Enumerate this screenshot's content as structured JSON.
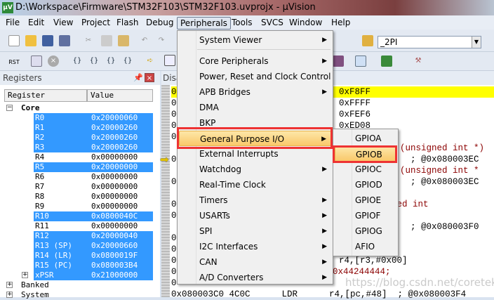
{
  "window": {
    "title": "D:\\Workspace\\Firmware\\STM32F103\\STM32F103.uvprojx - µVision",
    "logo": "µV"
  },
  "menubar": [
    "File",
    "Edit",
    "View",
    "Project",
    "Flash",
    "Debug",
    "Peripherals",
    "Tools",
    "SVCS",
    "Window",
    "Help"
  ],
  "toolbar": {
    "target_value": "_2PI",
    "rst_label": "RST"
  },
  "registers": {
    "title": "Registers",
    "col_register": "Register",
    "col_value": "Value",
    "core_label": "Core",
    "rows": [
      {
        "name": "R0",
        "value": "0x20000060",
        "sel": true
      },
      {
        "name": "R1",
        "value": "0x20000260",
        "sel": true
      },
      {
        "name": "R2",
        "value": "0x20000260",
        "sel": true
      },
      {
        "name": "R3",
        "value": "0x20000260",
        "sel": true
      },
      {
        "name": "R4",
        "value": "0x00000000",
        "sel": false
      },
      {
        "name": "R5",
        "value": "0x20000000",
        "sel": true
      },
      {
        "name": "R6",
        "value": "0x00000000",
        "sel": false
      },
      {
        "name": "R7",
        "value": "0x00000000",
        "sel": false
      },
      {
        "name": "R8",
        "value": "0x00000000",
        "sel": false
      },
      {
        "name": "R9",
        "value": "0x00000000",
        "sel": false
      },
      {
        "name": "R10",
        "value": "0x0800040C",
        "sel": true
      },
      {
        "name": "R11",
        "value": "0x00000000",
        "sel": false
      },
      {
        "name": "R12",
        "value": "0x20000040",
        "sel": true
      },
      {
        "name": "R13 (SP)",
        "value": "0x20000660",
        "sel": true
      },
      {
        "name": "R14 (LR)",
        "value": "0x0800019F",
        "sel": true
      },
      {
        "name": "R15 (PC)",
        "value": "0x080003B4",
        "sel": true
      },
      {
        "name": "xPSR",
        "value": "0x21000000",
        "sel": true
      }
    ],
    "banked_label": "Banked",
    "system_label": "System"
  },
  "disassembly": {
    "title": "Disa",
    "lines": [
      {
        "row": 0,
        "text": "0xF8FF",
        "red": false,
        "yellow": true
      },
      {
        "row": 1,
        "text": "0xFFFF",
        "red": false
      },
      {
        "row": 2,
        "text": "0xFEF6",
        "red": false
      },
      {
        "row": 3,
        "text": "0xED08",
        "red": false
      },
      {
        "row": 5,
        "text": "  = (unsigned int *)",
        "red": true
      },
      {
        "row": 6,
        "text": "      ; @0x080003EC",
        "red": false
      },
      {
        "row": 7,
        "text": "  = (unsigned int *",
        "red": true
      },
      {
        "row": 8,
        "text": "      ; @0x080003EC",
        "red": false
      },
      {
        "row": 9,
        "text": ")",
        "red": false
      },
      {
        "row": 10,
        "text": "R = (unsigned int",
        "red": true
      },
      {
        "row": 12,
        "text": "      ; @0x080003F0",
        "red": false
      },
      {
        "row": 15,
        "text": "r4,[r3,#0x00]",
        "red": false
      },
      {
        "row": 16,
        "text": "0x44244444;",
        "red": true
      }
    ],
    "last_line": "0x080003C0 4C0C      LDR      r4,[pc,#48]  ; @0x080003F4",
    "watermark": "https://blog.csdn.net/coreteker"
  },
  "peripherals_menu": {
    "items": [
      {
        "label": "System Viewer",
        "sub": true
      },
      {
        "label": "Core Peripherals",
        "sub": true
      },
      {
        "label": "Power, Reset and Clock Control",
        "sub": false
      },
      {
        "label": "APB Bridges",
        "sub": true
      },
      {
        "label": "DMA",
        "sub": false
      },
      {
        "label": "BKP",
        "sub": false
      },
      {
        "label": "General Purpose I/O",
        "sub": true,
        "hl": true
      },
      {
        "label": "External Interrupts",
        "sub": false
      },
      {
        "label": "Watchdog",
        "sub": true
      },
      {
        "label": "Real-Time Clock",
        "sub": false
      },
      {
        "label": "Timers",
        "sub": true
      },
      {
        "label": "USARTs",
        "sub": true
      },
      {
        "label": "SPI",
        "sub": true
      },
      {
        "label": "I2C Interfaces",
        "sub": true
      },
      {
        "label": "CAN",
        "sub": true
      },
      {
        "label": "A/D Converters",
        "sub": true
      }
    ]
  },
  "gpio_submenu": [
    "GPIOA",
    "GPIOB",
    "GPIOC",
    "GPIOD",
    "GPIOE",
    "GPIOF",
    "GPIOG",
    "AFIO"
  ],
  "colors": {
    "selection": "#3399ff",
    "highlight": "#f9c86a",
    "callout": "#ee3333"
  }
}
